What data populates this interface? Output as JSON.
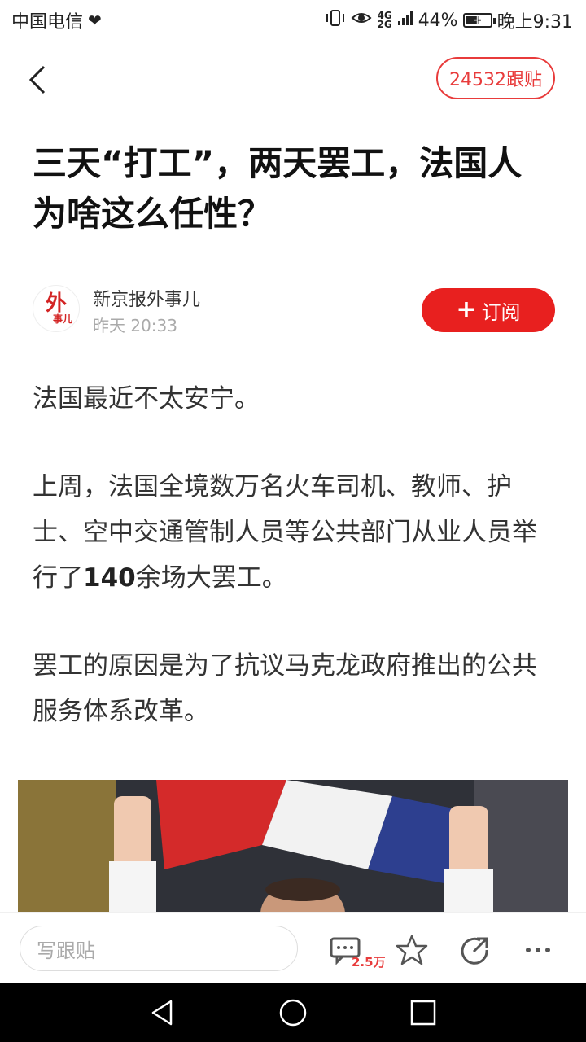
{
  "status_bar": {
    "carrier": "中国电信",
    "signal_top": "4G",
    "signal_bottom": "2G",
    "battery": "44%",
    "time": "晚上9:31"
  },
  "header": {
    "reply_count_label": "24532跟贴"
  },
  "article": {
    "title": "三天“打工”，两天罢工，法国人为啥这么任性？",
    "author": {
      "avatar_text_big": "外",
      "avatar_text_small": "事儿",
      "name": "新京报外事儿",
      "time": "昨天 20:33"
    },
    "subscribe_label": "订阅",
    "paragraphs": [
      "法国最近不太安宁。",
      "上周，法国全境数万名火车司机、教师、护士、空中交通管制人员等公共部门从业人员举行了",
      "余场大罢工。",
      "罢工的原因是为了抗议马克龙政府推出的公共服务体系改革。"
    ],
    "strike_count": "140"
  },
  "bottom_bar": {
    "reply_placeholder": "写跟贴",
    "comment_count": "2.5万"
  },
  "colors": {
    "accent": "#e8201f",
    "text": "#333333",
    "muted": "#aaaaaa"
  },
  "icons": [
    "back-arrow-icon",
    "plus-icon",
    "comment-icon",
    "star-icon",
    "share-icon",
    "more-icon",
    "nav-back-icon",
    "nav-home-icon",
    "nav-recents-icon"
  ]
}
